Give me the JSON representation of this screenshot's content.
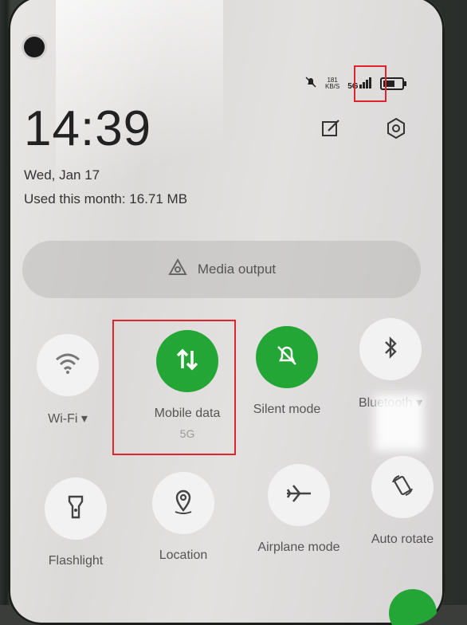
{
  "status_bar": {
    "speed_value": "181",
    "speed_unit": "KB/S",
    "network": "5G"
  },
  "clock": {
    "time": "14:39",
    "date": "Wed, Jan 17",
    "usage": "Used this month: 16.71 MB"
  },
  "media_output": {
    "label": "Media output"
  },
  "tiles": [
    {
      "label": "Wi-Fi ▾",
      "sub": "",
      "active": false,
      "icon": "wifi-icon"
    },
    {
      "label": "Mobile data",
      "sub": "5G",
      "active": true,
      "icon": "mobile-data-icon"
    },
    {
      "label": "Silent mode",
      "sub": "",
      "active": true,
      "icon": "bell-off-icon"
    },
    {
      "label": "Bluetooth ▾",
      "sub": "",
      "active": false,
      "icon": "bluetooth-icon"
    },
    {
      "label": "Flashlight",
      "sub": "",
      "active": false,
      "icon": "flashlight-icon"
    },
    {
      "label": "Location",
      "sub": "",
      "active": false,
      "icon": "location-icon"
    },
    {
      "label": "Airplane mode",
      "sub": "",
      "active": false,
      "icon": "airplane-icon"
    },
    {
      "label": "Auto rotate",
      "sub": "",
      "active": false,
      "icon": "auto-rotate-icon"
    }
  ],
  "colors": {
    "active": "#23a635",
    "highlight": "#e0242a"
  }
}
